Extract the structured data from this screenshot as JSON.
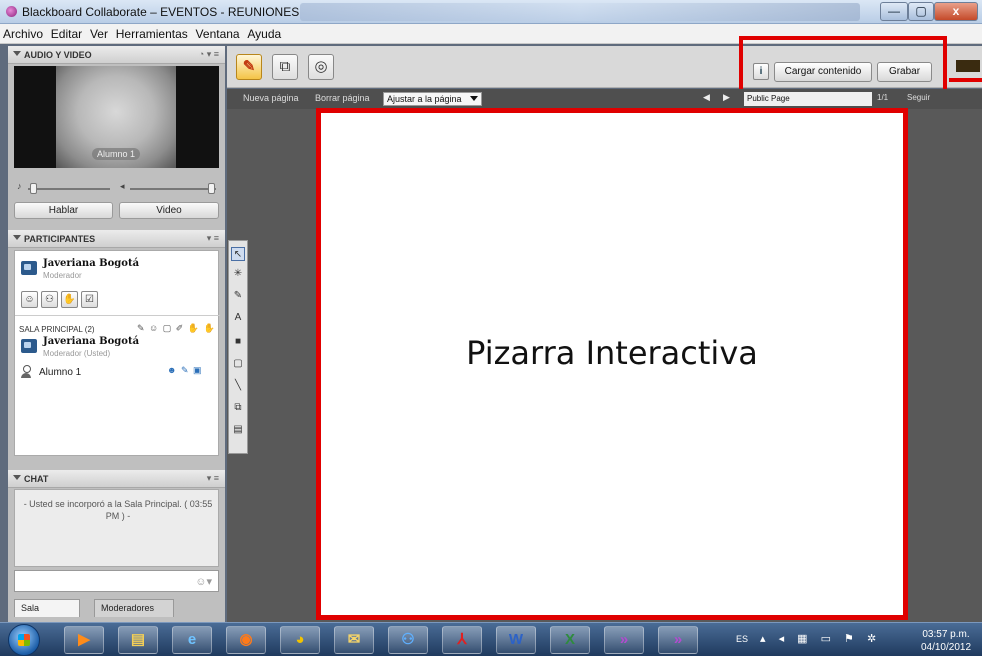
{
  "window": {
    "title": "Blackboard Collaborate – EVENTOS - REUNIONES",
    "controls": {
      "minimize": "—",
      "maximize": "▢",
      "close": "x"
    }
  },
  "menu": [
    "Archivo",
    "Editar",
    "Ver",
    "Herramientas",
    "Ventana",
    "Ayuda"
  ],
  "audio_video": {
    "title": "AUDIO Y VIDEO",
    "video_label": "Alumno 1",
    "talk_button": "Hablar",
    "video_button": "Video"
  },
  "participants": {
    "title": "PARTICIPANTES",
    "moderator": {
      "name": "Javeriana Bogotá",
      "role": "Moderador"
    },
    "room_label": "SALA PRINCIPAL (2)",
    "list": [
      {
        "name": "Javeriana Bogotá",
        "role": "Moderador (Usted)"
      },
      {
        "name": "Alumno 1",
        "role": ""
      }
    ]
  },
  "chat": {
    "title": "CHAT",
    "message": "- Usted se incorporó a la Sala Principal. ( 03:55 PM ) -",
    "input_placeholder": ""
  },
  "bottom_tabs": [
    "Sala",
    "Moderadores"
  ],
  "content_toolbar": {
    "info_button": "i",
    "load_button": "Cargar contenido",
    "record_button": "Grabar"
  },
  "page_nav": {
    "new_page": "Nueva página",
    "clear_page": "Borrar página",
    "fit_option": "Ajustar a la página",
    "page_select": "Public Page",
    "page_count": "1/1",
    "follow": "Seguir"
  },
  "whiteboard": {
    "text": "Pizarra Interactiva"
  },
  "taskbar": {
    "lang": "ES",
    "time": "03:57 p.m.",
    "date": "04/10/2012",
    "apps": [
      "media-player",
      "file-explorer",
      "internet-explorer",
      "firefox",
      "chrome",
      "outlook",
      "network",
      "acrobat",
      "word",
      "excel",
      "collaborate-1",
      "collaborate-2"
    ]
  },
  "colors": {
    "highlight": "#e00000",
    "panel_bg": "#bfbfbf",
    "pagebar_bg": "#4f4f4f"
  }
}
